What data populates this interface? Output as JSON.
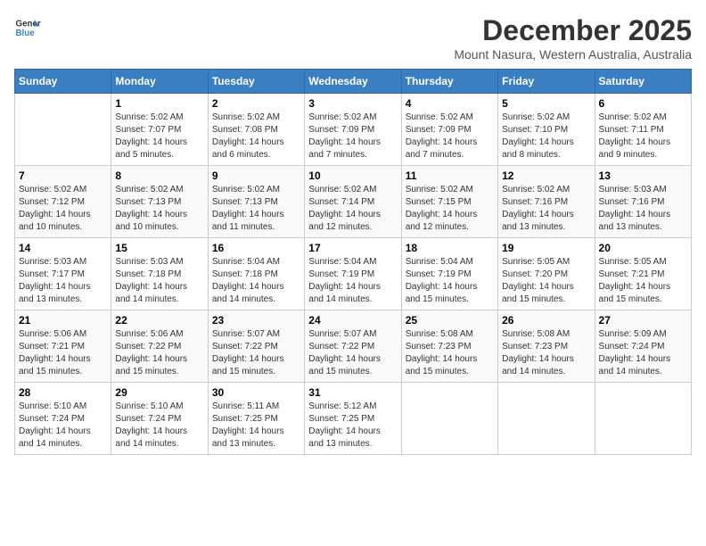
{
  "header": {
    "logo_line1": "General",
    "logo_line2": "Blue",
    "month": "December 2025",
    "location": "Mount Nasura, Western Australia, Australia"
  },
  "days_of_week": [
    "Sunday",
    "Monday",
    "Tuesday",
    "Wednesday",
    "Thursday",
    "Friday",
    "Saturday"
  ],
  "weeks": [
    [
      {
        "day": "",
        "info": ""
      },
      {
        "day": "1",
        "info": "Sunrise: 5:02 AM\nSunset: 7:07 PM\nDaylight: 14 hours\nand 5 minutes."
      },
      {
        "day": "2",
        "info": "Sunrise: 5:02 AM\nSunset: 7:08 PM\nDaylight: 14 hours\nand 6 minutes."
      },
      {
        "day": "3",
        "info": "Sunrise: 5:02 AM\nSunset: 7:09 PM\nDaylight: 14 hours\nand 7 minutes."
      },
      {
        "day": "4",
        "info": "Sunrise: 5:02 AM\nSunset: 7:09 PM\nDaylight: 14 hours\nand 7 minutes."
      },
      {
        "day": "5",
        "info": "Sunrise: 5:02 AM\nSunset: 7:10 PM\nDaylight: 14 hours\nand 8 minutes."
      },
      {
        "day": "6",
        "info": "Sunrise: 5:02 AM\nSunset: 7:11 PM\nDaylight: 14 hours\nand 9 minutes."
      }
    ],
    [
      {
        "day": "7",
        "info": "Sunrise: 5:02 AM\nSunset: 7:12 PM\nDaylight: 14 hours\nand 10 minutes."
      },
      {
        "day": "8",
        "info": "Sunrise: 5:02 AM\nSunset: 7:13 PM\nDaylight: 14 hours\nand 10 minutes."
      },
      {
        "day": "9",
        "info": "Sunrise: 5:02 AM\nSunset: 7:13 PM\nDaylight: 14 hours\nand 11 minutes."
      },
      {
        "day": "10",
        "info": "Sunrise: 5:02 AM\nSunset: 7:14 PM\nDaylight: 14 hours\nand 12 minutes."
      },
      {
        "day": "11",
        "info": "Sunrise: 5:02 AM\nSunset: 7:15 PM\nDaylight: 14 hours\nand 12 minutes."
      },
      {
        "day": "12",
        "info": "Sunrise: 5:02 AM\nSunset: 7:16 PM\nDaylight: 14 hours\nand 13 minutes."
      },
      {
        "day": "13",
        "info": "Sunrise: 5:03 AM\nSunset: 7:16 PM\nDaylight: 14 hours\nand 13 minutes."
      }
    ],
    [
      {
        "day": "14",
        "info": "Sunrise: 5:03 AM\nSunset: 7:17 PM\nDaylight: 14 hours\nand 13 minutes."
      },
      {
        "day": "15",
        "info": "Sunrise: 5:03 AM\nSunset: 7:18 PM\nDaylight: 14 hours\nand 14 minutes."
      },
      {
        "day": "16",
        "info": "Sunrise: 5:04 AM\nSunset: 7:18 PM\nDaylight: 14 hours\nand 14 minutes."
      },
      {
        "day": "17",
        "info": "Sunrise: 5:04 AM\nSunset: 7:19 PM\nDaylight: 14 hours\nand 14 minutes."
      },
      {
        "day": "18",
        "info": "Sunrise: 5:04 AM\nSunset: 7:19 PM\nDaylight: 14 hours\nand 15 minutes."
      },
      {
        "day": "19",
        "info": "Sunrise: 5:05 AM\nSunset: 7:20 PM\nDaylight: 14 hours\nand 15 minutes."
      },
      {
        "day": "20",
        "info": "Sunrise: 5:05 AM\nSunset: 7:21 PM\nDaylight: 14 hours\nand 15 minutes."
      }
    ],
    [
      {
        "day": "21",
        "info": "Sunrise: 5:06 AM\nSunset: 7:21 PM\nDaylight: 14 hours\nand 15 minutes."
      },
      {
        "day": "22",
        "info": "Sunrise: 5:06 AM\nSunset: 7:22 PM\nDaylight: 14 hours\nand 15 minutes."
      },
      {
        "day": "23",
        "info": "Sunrise: 5:07 AM\nSunset: 7:22 PM\nDaylight: 14 hours\nand 15 minutes."
      },
      {
        "day": "24",
        "info": "Sunrise: 5:07 AM\nSunset: 7:22 PM\nDaylight: 14 hours\nand 15 minutes."
      },
      {
        "day": "25",
        "info": "Sunrise: 5:08 AM\nSunset: 7:23 PM\nDaylight: 14 hours\nand 15 minutes."
      },
      {
        "day": "26",
        "info": "Sunrise: 5:08 AM\nSunset: 7:23 PM\nDaylight: 14 hours\nand 14 minutes."
      },
      {
        "day": "27",
        "info": "Sunrise: 5:09 AM\nSunset: 7:24 PM\nDaylight: 14 hours\nand 14 minutes."
      }
    ],
    [
      {
        "day": "28",
        "info": "Sunrise: 5:10 AM\nSunset: 7:24 PM\nDaylight: 14 hours\nand 14 minutes."
      },
      {
        "day": "29",
        "info": "Sunrise: 5:10 AM\nSunset: 7:24 PM\nDaylight: 14 hours\nand 14 minutes."
      },
      {
        "day": "30",
        "info": "Sunrise: 5:11 AM\nSunset: 7:25 PM\nDaylight: 14 hours\nand 13 minutes."
      },
      {
        "day": "31",
        "info": "Sunrise: 5:12 AM\nSunset: 7:25 PM\nDaylight: 14 hours\nand 13 minutes."
      },
      {
        "day": "",
        "info": ""
      },
      {
        "day": "",
        "info": ""
      },
      {
        "day": "",
        "info": ""
      }
    ]
  ]
}
